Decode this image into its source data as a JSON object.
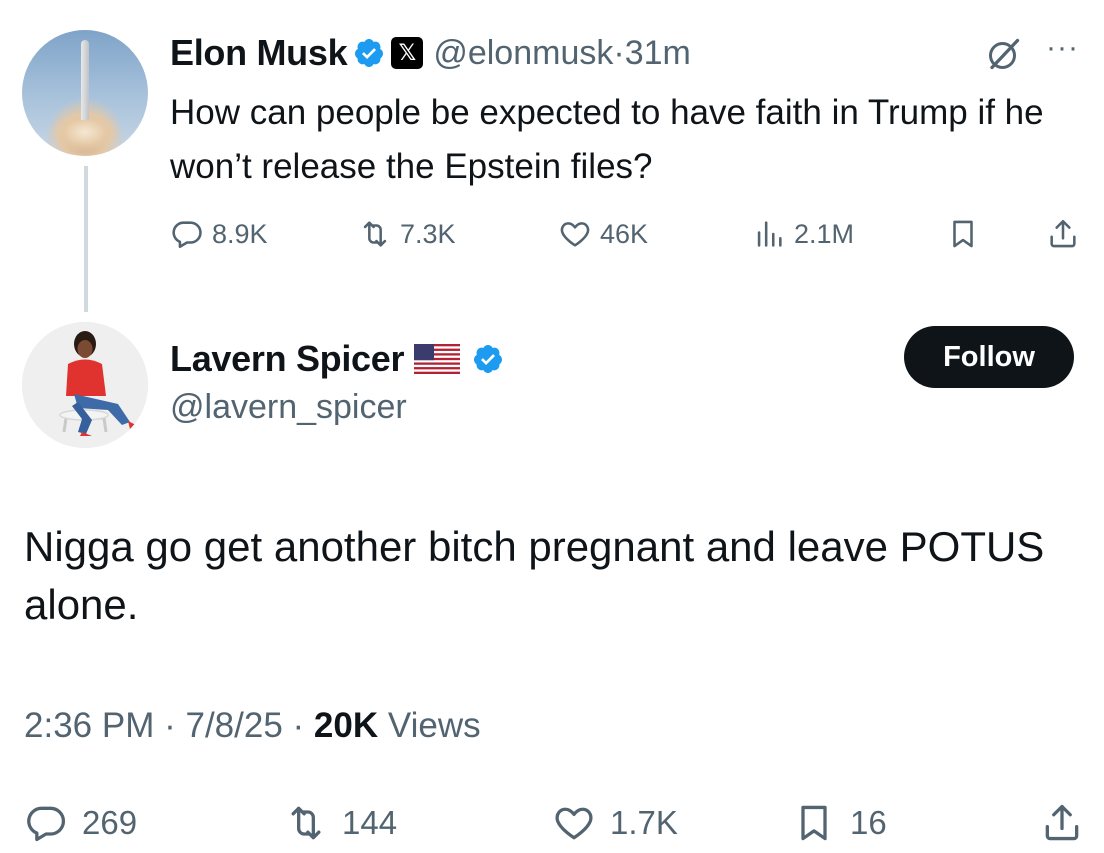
{
  "parent_tweet": {
    "author_name": "Elon Musk",
    "handle": "@elonmusk",
    "separator": "·",
    "time": "31m",
    "text": "How can people be expected to have faith in Trump if he won’t release the Epstein files?",
    "stats": {
      "replies": "8.9K",
      "reposts": "7.3K",
      "likes": "46K",
      "views": "2.1M"
    },
    "more_label": "···",
    "affiliate_badge": "𝕏"
  },
  "reply_tweet": {
    "author_name": "Lavern Spicer",
    "handle": "@lavern_spicer",
    "follow_label": "Follow",
    "text": "Nigga go get another bitch pregnant and leave POTUS alone.",
    "time": "2:36 PM",
    "date": "7/8/25",
    "views_count": "20K",
    "views_label": "Views",
    "meta_sep": "·",
    "stats": {
      "replies": "269",
      "reposts": "144",
      "likes": "1.7K",
      "bookmarks": "16"
    }
  },
  "colors": {
    "verified_blue": "#1d9bf0",
    "secondary_text": "#536471",
    "primary_text": "#0f1419"
  },
  "icons": [
    "verified-badge-icon",
    "x-affiliate-icon",
    "grok-icon",
    "more-icon",
    "reply-icon",
    "repost-icon",
    "like-icon",
    "views-icon",
    "bookmark-icon",
    "share-icon",
    "us-flag-icon"
  ]
}
